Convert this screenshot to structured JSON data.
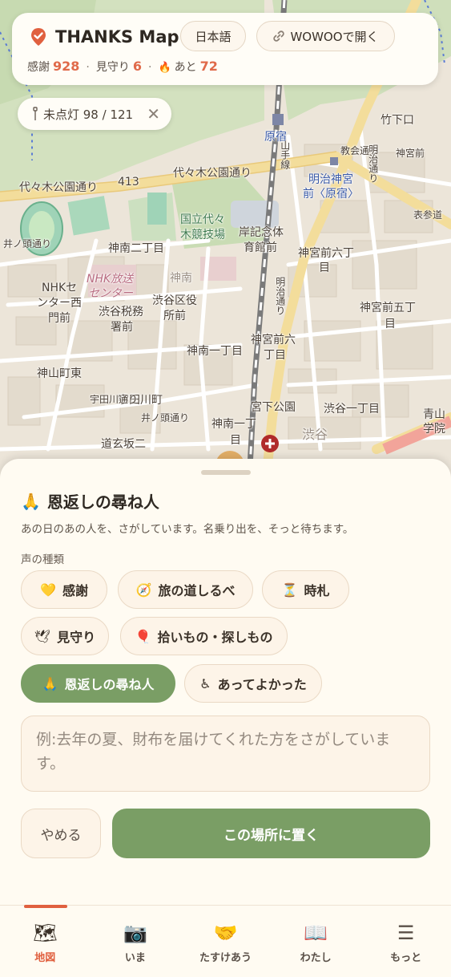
{
  "header": {
    "title": "THANKS Map",
    "lang_label": "日本語",
    "open_label": "WOWOOで開く",
    "stats": {
      "thanks_label": "感謝",
      "thanks_count": "928",
      "watch_label": "見守り",
      "watch_count": "6",
      "remaining_label": "あと",
      "remaining_count": "72"
    }
  },
  "lamp_filter": {
    "label": "未点灯 98 / 121",
    "close": "✕"
  },
  "map": {
    "labels": {
      "harajuku": "原宿",
      "takeshita": "竹下口",
      "jingumae": "神宮前",
      "meiji_jingu": "明治神宮",
      "meiji_jingu_mae": "前〈原宿〉",
      "church": "教会通り",
      "meiji_dori": "明治通り",
      "omotesando": "表参道",
      "yoyogi_koen": "代々木公園通り",
      "yoyogi_koen_2": "代々木公園通り",
      "route413": "413",
      "yamanote": "山手線",
      "kokuritsu1": "国立代々",
      "kokuritsu2": "木競技場",
      "kishi1": "岸記念体",
      "kishi2": "育館前",
      "jinnan2": "神南二丁目",
      "jingumae6": "神宮前六丁",
      "jingumae6b": "目",
      "inokashira": "井ノ頭通り",
      "nhk1": "NHKセ",
      "nhk2": "ンター西",
      "nhk3": "門前",
      "nhk_hoso1": "NHK放送",
      "nhk_hoso2": "センター",
      "shibuya_zeimu1": "渋谷税務",
      "shibuya_zeimu2": "署前",
      "jinnan": "神南",
      "shibuya_kuyaku1": "渋谷区役",
      "shibuya_kuyaku2": "所前",
      "meiji_dori2": "明治通り",
      "jingumae5a": "神宮前五丁",
      "jingumae5b": "目",
      "jingumae6c": "神宮前六",
      "jingumae6d": "丁目",
      "jinnan1": "神南一丁目",
      "kamiyama": "神山町東",
      "udagawa": "宇田川町",
      "udagawa_dori": "宇田川通り",
      "inokashira2": "井ノ頭通り",
      "miyashita": "宮下公園",
      "shibuya1": "渋谷一丁目",
      "jinnan1b": "神南一丁",
      "jinnan1c": "目",
      "shibuya": "渋谷",
      "dogenzaka": "道玄坂二",
      "aoyama": "青山",
      "gakuin": "学院"
    }
  },
  "sheet": {
    "title_icon": "🙏",
    "title": "恩返しの尋ね人",
    "subtitle": "あの日のあの人を、さがしています。名乗り出を、そっと待ちます。",
    "section_label": "声の種類",
    "categories": [
      {
        "icon": "💛",
        "label": "感謝"
      },
      {
        "icon": "🧭",
        "label": "旅の道しるべ"
      },
      {
        "icon": "⏳",
        "label": "時札"
      },
      {
        "icon": "🕊",
        "label": "見守り"
      },
      {
        "icon": "🎈",
        "label": "拾いもの・探しもの"
      },
      {
        "icon": "🙏",
        "label": "恩返しの尋ね人"
      },
      {
        "icon": "♿",
        "label": "あってよかった"
      }
    ],
    "message_placeholder": "例:去年の夏、財布を届けてくれた方をさがしています。",
    "cancel_label": "やめる",
    "submit_label": "この場所に置く"
  },
  "nav": {
    "items": [
      {
        "icon": "🗺",
        "label": "地図"
      },
      {
        "icon": "📷",
        "label": "いま"
      },
      {
        "icon": "🤝",
        "label": "たすけあう"
      },
      {
        "icon": "📖",
        "label": "わたし"
      },
      {
        "icon": "☰",
        "label": "もっと"
      }
    ]
  },
  "colors": {
    "accent_green": "#7a9e65",
    "accent_orange": "#e0603f",
    "count_red": "#e06a4a",
    "sheet_bg": "#fffbf2"
  }
}
